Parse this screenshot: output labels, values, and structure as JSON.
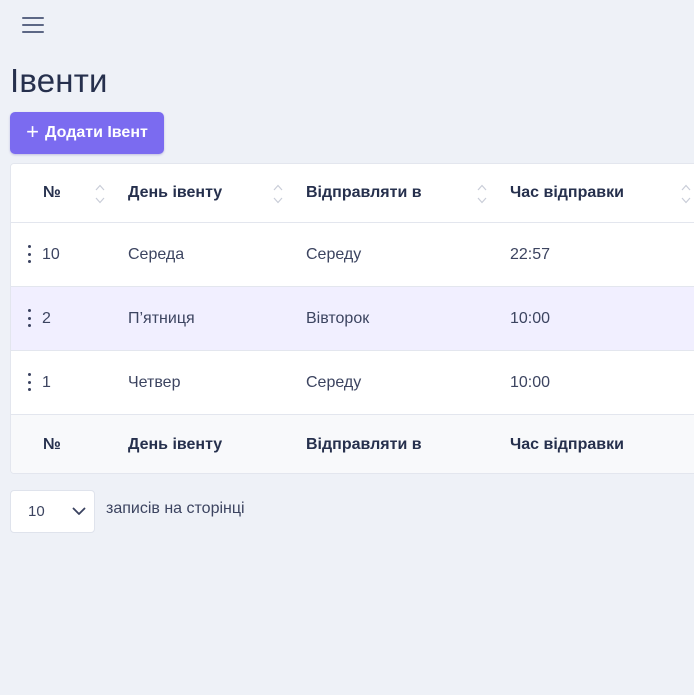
{
  "page": {
    "title": "Івенти",
    "add_button_label": "Додати Івент"
  },
  "table": {
    "columns": [
      "№",
      "День івенту",
      "Відправляти в",
      "Час відправки"
    ],
    "rows": [
      {
        "id": "10",
        "day": "Середа",
        "send_on": "Середу",
        "time": "22:57"
      },
      {
        "id": "2",
        "day": "П’ятниця",
        "send_on": "Вівторок",
        "time": "10:00"
      },
      {
        "id": "1",
        "day": "Четвер",
        "send_on": "Середу",
        "time": "10:00"
      }
    ]
  },
  "pagination": {
    "page_size": "10",
    "label": "записів на сторінці"
  },
  "colors": {
    "accent": "#7b6bf0",
    "highlight_row": "#f1efff",
    "background": "#eef1f7"
  },
  "icons": [
    "hamburger-menu-icon",
    "plus-icon",
    "sort-icon",
    "row-actions-icon",
    "chevron-down-icon"
  ]
}
